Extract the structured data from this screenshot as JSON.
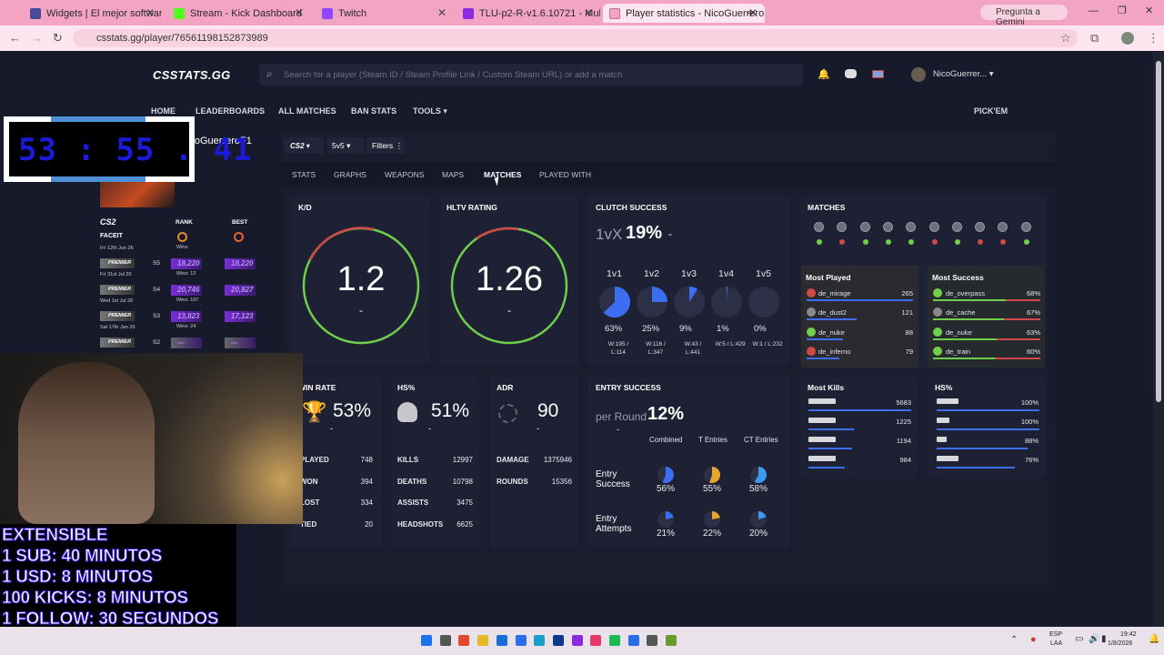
{
  "browser": {
    "tabs": [
      {
        "label": "Widgets | El mejor software pa",
        "color": "#4a4a9a"
      },
      {
        "label": "Stream - Kick Dashboard",
        "color": "#53fc18"
      },
      {
        "label": "Twitch",
        "color": "#9146ff"
      },
      {
        "label": "TLU-p2-R-v1.6.10721 - Multipa",
        "color": "#8a2be2"
      },
      {
        "label": "Player statistics - NicoGuerrero",
        "color": "#f3a4c3"
      }
    ],
    "gemini": "Pregunta a Gemini",
    "url": "csstats.gg/player/76561198152873989"
  },
  "site": {
    "logo": "CSSTATS.GG",
    "search_placeholder": "Search for a player (Steam ID / Steam Profile Link / Custom Steam URL) or add a match",
    "username": "NicoGuerrer...",
    "nav": [
      "HOME",
      "LEADERBOARDS",
      "ALL MATCHES",
      "BAN STATS",
      "TOOLS",
      "PICK'EM"
    ],
    "player_name": "NicoGuerreroF1",
    "filters": {
      "game": "CS2",
      "mode": "5v5",
      "filters": "Filters"
    },
    "subtabs": [
      "STATS",
      "GRAPHS",
      "WEAPONS",
      "MAPS",
      "MATCHES",
      "PLAYED WITH"
    ],
    "timer": "53 : 55 . 41"
  },
  "sidebar": {
    "game": "CS2",
    "rank_h": "RANK",
    "best_h": "BEST",
    "faceit": "FACEIT",
    "faceit_date": "Fri 12th Jun 26",
    "faceit_wins": "Wins:",
    "rows": [
      {
        "label": "PREMIER",
        "date": "Fri 31st Jul 26",
        "season": "S5",
        "rank": "18,220",
        "best": "18,220",
        "wins": "Wins: 12"
      },
      {
        "label": "PREMIER",
        "date": "Wed 1st Jul 26",
        "season": "S4",
        "rank": "20,746",
        "best": "20,827",
        "wins": "Wins: 107"
      },
      {
        "label": "PREMIER",
        "date": "Sat 17th Jan 26",
        "season": "S3",
        "rank": "13,823",
        "best": "17,123",
        "wins": "Wins: 24"
      },
      {
        "label": "PREMIER",
        "date": "",
        "season": "S2",
        "rank": "---",
        "best": "---",
        "wins": ""
      }
    ]
  },
  "kd": {
    "title": "K/D",
    "value": "1.2",
    "sub": "-"
  },
  "hltv": {
    "title": "HLTV RATING",
    "value": "1.26",
    "sub": "-"
  },
  "clutch": {
    "title": "CLUTCH SUCCESS",
    "prefix": "1vX",
    "value": "19%",
    "suffix": "-",
    "items": [
      {
        "label": "1v1",
        "pct": "63%",
        "wl": "W:195 / L:114",
        "fill": 0.63
      },
      {
        "label": "1v2",
        "pct": "25%",
        "wl": "W:116 / L:347",
        "fill": 0.25
      },
      {
        "label": "1v3",
        "pct": "9%",
        "wl": "W:43 / L:441",
        "fill": 0.09
      },
      {
        "label": "1v4",
        "pct": "1%",
        "wl": "W:5 / L:429",
        "fill": 0.01
      },
      {
        "label": "1v5",
        "pct": "0%",
        "wl": "W:1 / L:232",
        "fill": 0.0
      }
    ]
  },
  "matches": {
    "title": "MATCHES",
    "results": [
      "win",
      "loss",
      "win",
      "win",
      "win",
      "loss",
      "win",
      "loss",
      "loss",
      "win"
    ]
  },
  "most_played": {
    "title": "Most Played",
    "items": [
      {
        "map": "de_mirage",
        "val": "265"
      },
      {
        "map": "de_dust2",
        "val": "121"
      },
      {
        "map": "de_nuke",
        "val": "88"
      },
      {
        "map": "de_inferno",
        "val": "79"
      }
    ]
  },
  "most_success": {
    "title": "Most Success",
    "items": [
      {
        "map": "de_overpass",
        "val": "68%"
      },
      {
        "map": "de_cache",
        "val": "67%"
      },
      {
        "map": "de_nuke",
        "val": "63%"
      },
      {
        "map": "de_train",
        "val": "60%"
      }
    ]
  },
  "winrate": {
    "title": "WIN RATE",
    "value": "53%",
    "sub": "-",
    "rows": [
      {
        "k": "PLAYED",
        "v": "748"
      },
      {
        "k": "WON",
        "v": "394"
      },
      {
        "k": "LOST",
        "v": "334"
      },
      {
        "k": "TIED",
        "v": "20"
      }
    ]
  },
  "hs": {
    "title": "HS%",
    "value": "51%",
    "sub": "-",
    "rows": [
      {
        "k": "KILLS",
        "v": "12997"
      },
      {
        "k": "DEATHS",
        "v": "10798"
      },
      {
        "k": "ASSISTS",
        "v": "3475"
      },
      {
        "k": "HEADSHOTS",
        "v": "6625"
      }
    ]
  },
  "adr": {
    "title": "ADR",
    "value": "90",
    "sub": "-",
    "rows": [
      {
        "k": "DAMAGE",
        "v": "1375946"
      },
      {
        "k": "ROUNDS",
        "v": "15356"
      }
    ]
  },
  "entry": {
    "title": "ENTRY SUCCESS",
    "per_round": "per Round",
    "value": "12%",
    "sub": "-",
    "cols": [
      "Combined",
      "T Entries",
      "CT Entries"
    ],
    "success_label": "Entry Success",
    "attempts_label": "Entry Attempts",
    "success": [
      {
        "pct": "56%",
        "fill": 0.56,
        "color": "#3b6ef0"
      },
      {
        "pct": "55%",
        "fill": 0.55,
        "color": "#e8a42c"
      },
      {
        "pct": "58%",
        "fill": 0.58,
        "color": "#3b9af0"
      }
    ],
    "attempts": [
      {
        "pct": "21%",
        "fill": 0.21,
        "color": "#3b6ef0"
      },
      {
        "pct": "22%",
        "fill": 0.22,
        "color": "#e8a42c"
      },
      {
        "pct": "20%",
        "fill": 0.2,
        "color": "#3b9af0"
      }
    ]
  },
  "most_kills": {
    "title": "Most Kills",
    "items": [
      "5683",
      "1225",
      "1194",
      "984"
    ]
  },
  "hs_weapons": {
    "title": "HS%",
    "items": [
      "100%",
      "100%",
      "88%",
      "76%"
    ]
  },
  "overlay": [
    "EXTENSIBLE",
    "1 SUB: 40 MINUTOS",
    "1 USD: 8 MINUTOS",
    "100 KICKS: 8 MINUTOS",
    "1 FOLLOW: 30 SEGUNDOS"
  ],
  "taskbar": {
    "lang1": "ESP",
    "lang2": "LAA",
    "time": "19:42",
    "date": "1/8/2026"
  }
}
